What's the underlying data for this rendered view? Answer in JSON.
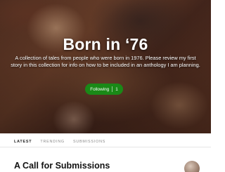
{
  "publication": {
    "title": "Born in ‘76",
    "description": "A collection of tales from people who were born in 1976. Please review my first story in this collection for info on how to be included in an anthology I am planning.",
    "follow_button": {
      "label": "Following",
      "count": "1"
    }
  },
  "tabs": [
    {
      "label": "LATEST",
      "active": true
    },
    {
      "label": "TRENDING",
      "active": false
    },
    {
      "label": "SUBMISSIONS",
      "active": false
    }
  ],
  "stories": [
    {
      "title": "A Call for Submissions"
    }
  ],
  "colors": {
    "accent": "#1a8917"
  }
}
